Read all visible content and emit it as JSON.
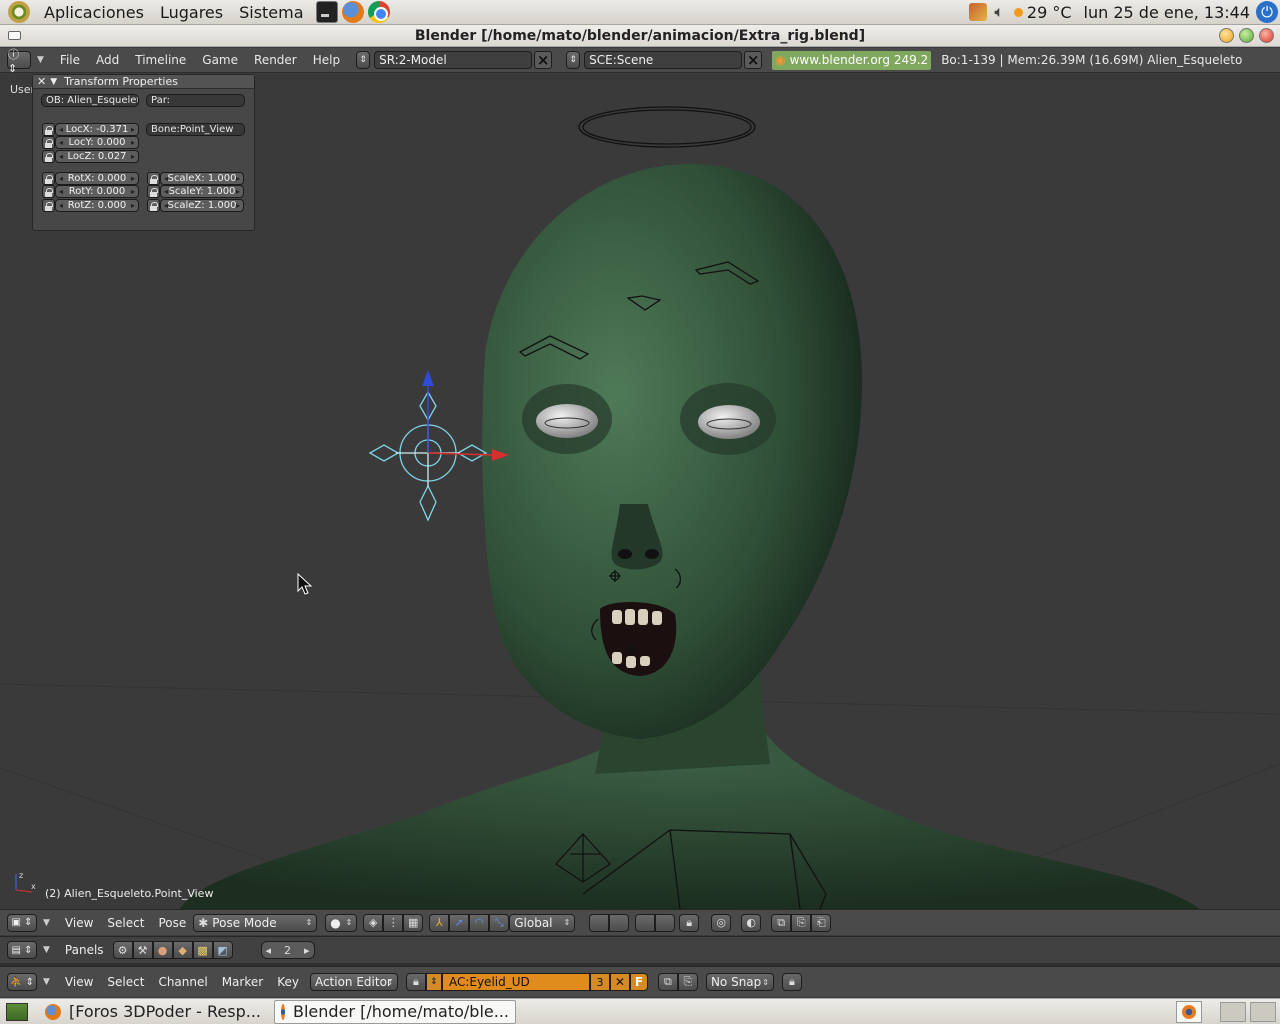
{
  "top_panel": {
    "menus": [
      "Aplicaciones",
      "Lugares",
      "Sistema"
    ],
    "temperature": "29 °C",
    "datetime": "lun 25 de ene, 13:44"
  },
  "window": {
    "title": "Blender [/home/mato/blender/animacion/Extra_rig.blend]"
  },
  "blender_header": {
    "menus": [
      "File",
      "Add",
      "Timeline",
      "Game",
      "Render",
      "Help"
    ],
    "screen_field": "SR:2-Model",
    "scene_field": "SCE:Scene",
    "url": "www.blender.org 249.2",
    "stats": "Bo:1-139  | Mem:26.39M (16.69M) Alien_Esqueleto"
  },
  "viewport": {
    "view_label": "User",
    "object_info": "(2) Alien_Esqueleto.Point_View"
  },
  "transform_panel": {
    "title": "Transform Properties",
    "ob_field": "OB: Alien_Esqueleto",
    "par_field": "Par:",
    "bone_field": "Bone:Point_View",
    "loc_x": "LocX: -0.371",
    "loc_y": "LocY: 0.000",
    "loc_z": "LocZ: 0.027",
    "rot_x": "RotX: 0.000",
    "rot_y": "RotY: 0.000",
    "rot_z": "RotZ: 0.000",
    "scale_x": "ScaleX: 1.000",
    "scale_y": "ScaleY: 1.000",
    "scale_z": "ScaleZ: 1.000"
  },
  "view3d_header": {
    "menus": [
      "View",
      "Select",
      "Pose"
    ],
    "mode": "Pose Mode",
    "orientation": "Global"
  },
  "buttons_header": {
    "panels_label": "Panels",
    "frame_value": "2"
  },
  "action_header": {
    "menus": [
      "View",
      "Select",
      "Channel",
      "Marker",
      "Key"
    ],
    "editor_type": "Action Editor",
    "action_name": "AC:Eyelid_UD",
    "action_users": "3",
    "fake_user": "F",
    "snap": "No Snap"
  },
  "taskbar": {
    "tasks": [
      "[Foros 3DPoder - Resp...",
      "Blender [/home/mato/ble..."
    ]
  },
  "colors": {
    "skin": "#2e4a34",
    "orange_field": "#e08c1c",
    "url_green": "#7fa85e",
    "bone_cyan": "#7fd4e6"
  }
}
